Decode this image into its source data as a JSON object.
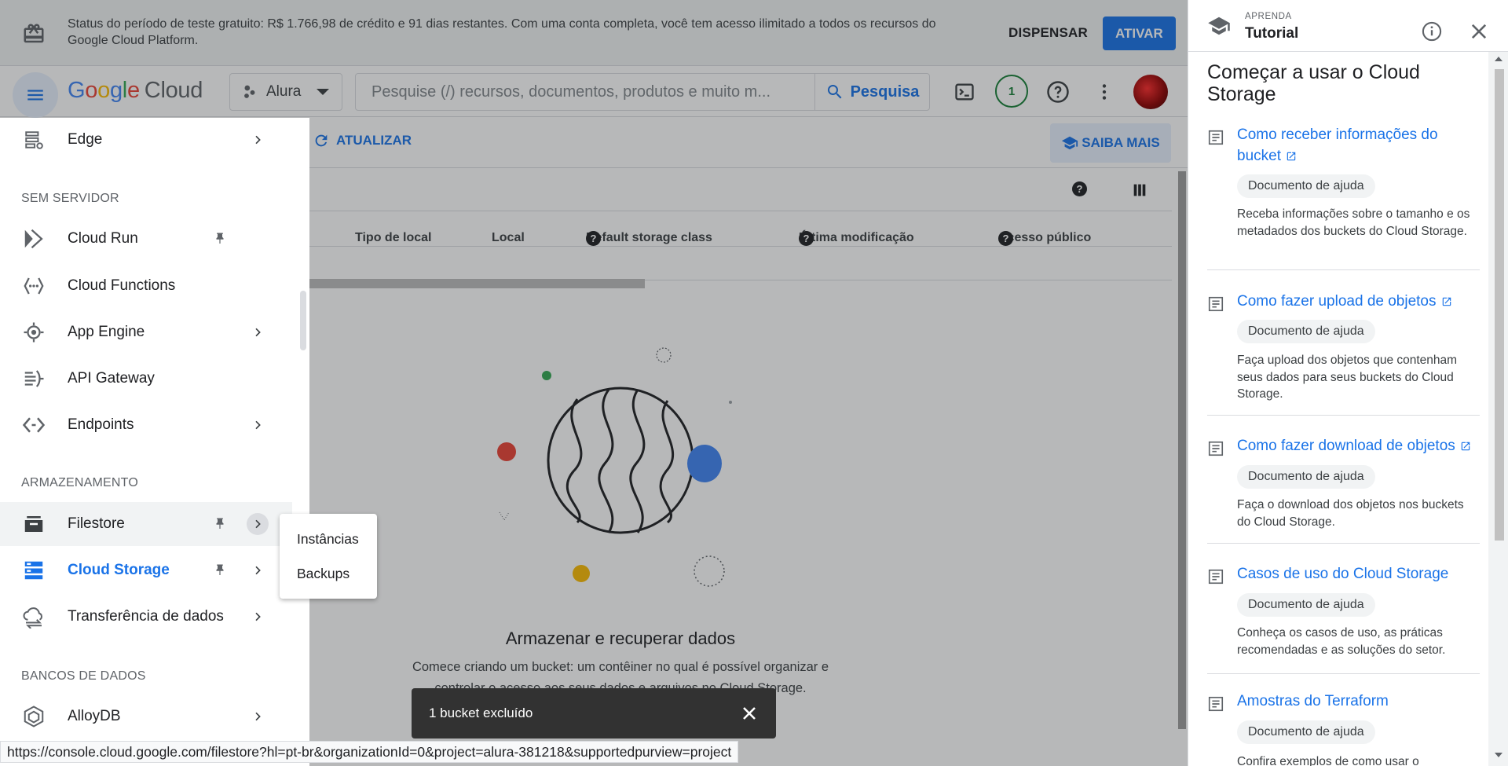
{
  "trial_banner": {
    "message": "Status do período de teste gratuito: R$ 1.766,98 de crédito e 91 dias restantes. Com uma conta completa, você tem acesso ilimitado a todos os recursos do Google Cloud Platform.",
    "dismiss_label": "DISPENSAR",
    "activate_label": "ATIVAR"
  },
  "header": {
    "logo_google": "Google",
    "logo_cloud": "Cloud",
    "project_name": "Alura",
    "search_placeholder": "Pesquise (/) recursos, documentos, produtos e muito m...",
    "search_button": "Pesquisa",
    "notification_count": "1"
  },
  "toolbar": {
    "refresh_label": "ATUALIZAR",
    "learn_more_label": "SAIBA MAIS"
  },
  "table": {
    "columns": [
      {
        "label": "Tipo de local",
        "help": false
      },
      {
        "label": "Local",
        "help": false
      },
      {
        "label": "Default storage class",
        "help": true
      },
      {
        "label": "Última modificação",
        "help": true
      },
      {
        "label": "Acesso público",
        "help": true
      }
    ]
  },
  "empty_state": {
    "title": "Armazenar e recuperar dados",
    "description": "Comece criando um bucket: um contêiner no qual é possível organizar e controlar o acesso aos seus dados e arquivos no Cloud Storage."
  },
  "nav": {
    "items": [
      {
        "label": "Edge",
        "icon": "edge-icon",
        "chevron": true,
        "pin": false
      },
      {
        "section": "SEM SERVIDOR"
      },
      {
        "label": "Cloud Run",
        "icon": "cloud-run-icon",
        "chevron": false,
        "pin": true
      },
      {
        "label": "Cloud Functions",
        "icon": "cloud-functions-icon",
        "chevron": false,
        "pin": false
      },
      {
        "label": "App Engine",
        "icon": "app-engine-icon",
        "chevron": true,
        "pin": false
      },
      {
        "label": "API Gateway",
        "icon": "api-gateway-icon",
        "chevron": false,
        "pin": false
      },
      {
        "label": "Endpoints",
        "icon": "endpoints-icon",
        "chevron": true,
        "pin": false
      },
      {
        "section": "ARMAZENAMENTO"
      },
      {
        "label": "Filestore",
        "icon": "filestore-icon",
        "chevron": true,
        "pin": true
      },
      {
        "label": "Cloud Storage",
        "icon": "cloud-storage-icon",
        "chevron": true,
        "pin": true
      },
      {
        "label": "Transferência de dados",
        "icon": "data-transfer-icon",
        "chevron": true,
        "pin": false
      },
      {
        "section": "BANCOS DE DADOS"
      },
      {
        "label": "AlloyDB",
        "icon": "alloydb-icon",
        "chevron": true,
        "pin": false
      }
    ]
  },
  "submenu": {
    "items": [
      "Instâncias",
      "Backups"
    ]
  },
  "snackbar": {
    "message": "1 bucket excluído"
  },
  "status_url": "https://console.cloud.google.com/filestore?hl=pt-br&organizationId=0&project=alura-381218&supportedpurview=project",
  "tutorial": {
    "eyebrow": "APRENDA",
    "title": "Tutorial",
    "heading": "Começar a usar o Cloud Storage",
    "cards": [
      {
        "title": "Como receber informações do bucket",
        "chip": "Documento de ajuda",
        "desc": "Receba informações sobre o tamanho e os metadados dos buckets do Cloud Storage."
      },
      {
        "title": "Como fazer upload de objetos",
        "chip": "Documento de ajuda",
        "desc": "Faça upload dos objetos que contenham seus dados para seus buckets do Cloud Storage."
      },
      {
        "title": "Como fazer download de objetos",
        "chip": "Documento de ajuda",
        "desc": "Faça o download dos objetos nos buckets do Cloud Storage."
      },
      {
        "title": "Casos de uso do Cloud Storage",
        "chip": "Documento de ajuda",
        "desc": "Conheça os casos de uso, as práticas recomendadas e as soluções do setor."
      },
      {
        "title": "Amostras do Terraform",
        "chip": "Documento de ajuda",
        "desc": "Confira exemplos de como usar o"
      }
    ]
  },
  "colors": {
    "accent": "#1a73e8",
    "nav_active": "#1a73e8",
    "badge": "#188038",
    "snackbar": "#323232"
  }
}
